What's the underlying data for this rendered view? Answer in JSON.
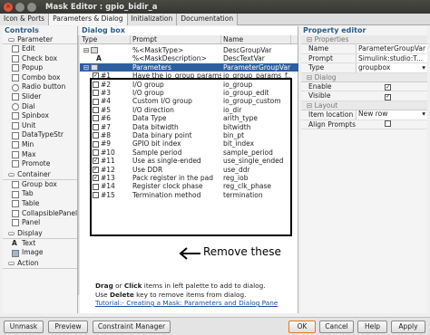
{
  "window": {
    "title": "Mask Editor : gpio_bidir_a"
  },
  "tabs": [
    "Icon & Ports",
    "Parameters & Dialog",
    "Initialization",
    "Documentation"
  ],
  "controls": {
    "header": "Controls",
    "sections": [
      {
        "label": "Parameter",
        "items": [
          "Edit",
          "Check box",
          "Popup",
          "Combo box",
          "Radio button",
          "Slider",
          "Dial",
          "Spinbox",
          "Unit",
          "DataTypeStr",
          "Min",
          "Max",
          "Promote"
        ]
      },
      {
        "label": "Container",
        "items": [
          "Group box",
          "Tab",
          "Table",
          "CollapsiblePanel",
          "Panel"
        ]
      },
      {
        "label": "Display",
        "items": [
          "Text",
          "Image"
        ]
      },
      {
        "label": "Action",
        "items": []
      }
    ]
  },
  "dialog": {
    "header": "Dialog box",
    "columns": {
      "type": "Type",
      "prompt": "Prompt",
      "name": "Name"
    },
    "rows": [
      {
        "type": "",
        "prompt": "%<MaskType>",
        "name": "DescGroupVar",
        "kind": "group"
      },
      {
        "type": "A",
        "prompt": "%<MaskDescription>",
        "name": "DescTextVar",
        "kind": "text"
      },
      {
        "type": "",
        "prompt": "Parameters",
        "name": "ParameterGroupVar",
        "kind": "param-group"
      },
      {
        "type": "#1",
        "prompt": "Have the io_group params...",
        "name": "io_group_params_f...",
        "kind": "check"
      },
      {
        "type": "#2",
        "prompt": "I/O group",
        "name": "io_group",
        "kind": "edit"
      },
      {
        "type": "#3",
        "prompt": "I/O group",
        "name": "io_group_edit",
        "kind": "edit"
      },
      {
        "type": "#4",
        "prompt": "Custom I/O group",
        "name": "io_group_custom",
        "kind": "edit"
      },
      {
        "type": "#5",
        "prompt": "I/O direction",
        "name": "io_dir",
        "kind": "edit"
      },
      {
        "type": "#6",
        "prompt": "Data Type",
        "name": "arith_type",
        "kind": "edit"
      },
      {
        "type": "#7",
        "prompt": "Data bitwidth",
        "name": "bitwidth",
        "kind": "edit"
      },
      {
        "type": "#8",
        "prompt": "Data binary point",
        "name": "bin_pt",
        "kind": "edit"
      },
      {
        "type": "#9",
        "prompt": "GPIO bit index",
        "name": "bit_index",
        "kind": "edit"
      },
      {
        "type": "#10",
        "prompt": "Sample period",
        "name": "sample_period",
        "kind": "edit"
      },
      {
        "type": "#11",
        "prompt": "Use as single-ended",
        "name": "use_single_ended",
        "kind": "check"
      },
      {
        "type": "#12",
        "prompt": "Use DDR",
        "name": "use_ddr",
        "kind": "check"
      },
      {
        "type": "#13",
        "prompt": "Pack register in the pad",
        "name": "reg_iob",
        "kind": "check"
      },
      {
        "type": "#14",
        "prompt": "Register clock phase",
        "name": "reg_clk_phase",
        "kind": "edit"
      },
      {
        "type": "#15",
        "prompt": "Termination method",
        "name": "termination",
        "kind": "edit"
      }
    ],
    "annotation": "Remove these",
    "hint": {
      "line1_a": "Drag",
      "line1_b": " or ",
      "line1_c": "Click",
      "line1_d": " items in left palette to add to dialog.",
      "line2_a": "Use ",
      "line2_b": "Delete",
      "line2_c": " key to remove items from dialog.",
      "link": "Tutorial:- Creating a Mask: Parameters and Dialog Pane"
    }
  },
  "property_editor": {
    "header": "Property editor",
    "sections": [
      {
        "label": "Properties",
        "rows": [
          {
            "key": "Name",
            "value": "ParameterGroupVar"
          },
          {
            "key": "Prompt",
            "value": "Simulink:studio:T..."
          },
          {
            "key": "Type",
            "value": "groupbox"
          }
        ]
      },
      {
        "label": "Dialog",
        "rows": [
          {
            "key": "Enable",
            "value": "checked"
          },
          {
            "key": "Visible",
            "value": "checked"
          }
        ]
      },
      {
        "label": "Layout",
        "rows": [
          {
            "key": "Item location",
            "value": "New row"
          },
          {
            "key": "Align Prompts",
            "value": ""
          }
        ]
      }
    ]
  },
  "buttons": {
    "unmask": "Unmask",
    "preview": "Preview",
    "constraint": "Constraint Manager",
    "ok": "OK",
    "cancel": "Cancel",
    "help": "Help",
    "apply": "Apply"
  },
  "colors": {
    "selection": "#2d5fa0",
    "link": "#1a4fa0",
    "ok_border": "#e07a20"
  }
}
